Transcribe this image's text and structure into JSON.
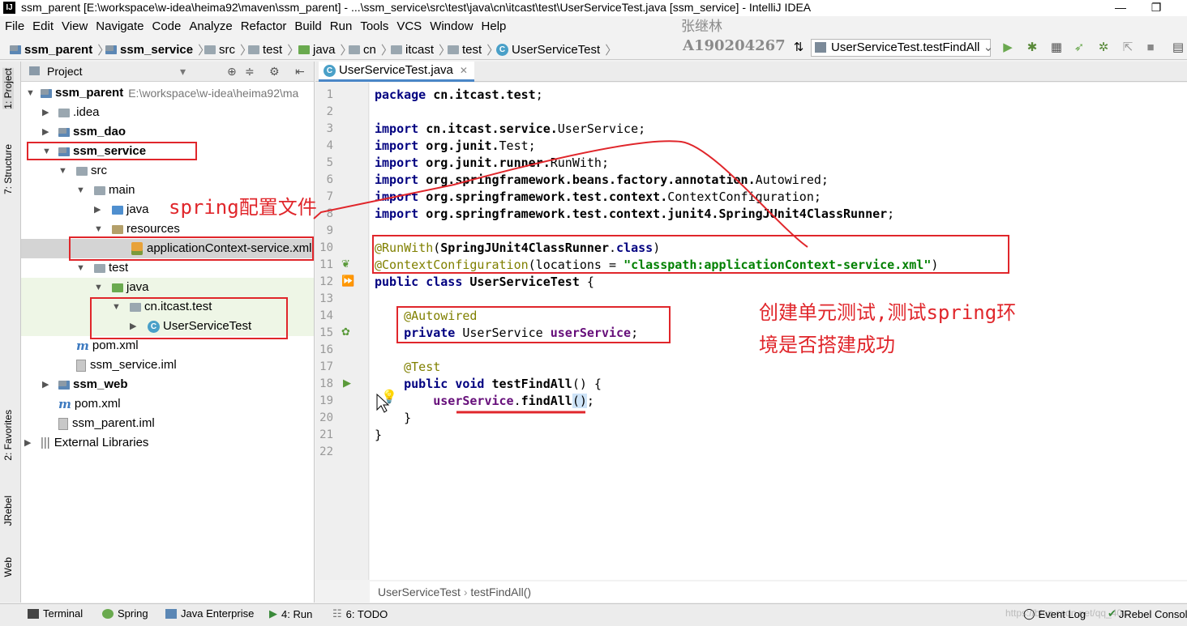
{
  "window": {
    "title": "ssm_parent [E:\\workspace\\w-idea\\heima92\\maven\\ssm_parent] - ...\\ssm_service\\src\\test\\java\\cn\\itcast\\test\\UserServiceTest.java [ssm_service] - IntelliJ IDEA",
    "app_icon_text": "IJ"
  },
  "menu": [
    "File",
    "Edit",
    "View",
    "Navigate",
    "Code",
    "Analyze",
    "Refactor",
    "Build",
    "Run",
    "Tools",
    "VCS",
    "Window",
    "Help"
  ],
  "watermark": {
    "name": "张继林",
    "id": "A190204267"
  },
  "navbar": {
    "crumbs": [
      "ssm_parent",
      "ssm_service",
      "src",
      "test",
      "java",
      "cn",
      "itcast",
      "test",
      "UserServiceTest"
    ],
    "run_config": "UserServiceTest.testFindAll"
  },
  "left_stripe": {
    "tabs": [
      "1: Project",
      "7: Structure",
      "2: Favorites",
      "JRebel",
      "Web"
    ]
  },
  "project": {
    "header": "Project",
    "tree": [
      {
        "label": "ssm_parent",
        "extra": "E:\\workspace\\w-idea\\heima92\\ma"
      },
      {
        "label": ".idea"
      },
      {
        "label": "ssm_dao"
      },
      {
        "label": "ssm_service"
      },
      {
        "label": "src"
      },
      {
        "label": "main"
      },
      {
        "label": "java"
      },
      {
        "label": "resources"
      },
      {
        "label": "applicationContext-service.xml"
      },
      {
        "label": "test"
      },
      {
        "label": "java"
      },
      {
        "label": "cn.itcast.test"
      },
      {
        "label": "UserServiceTest"
      },
      {
        "label": "pom.xml"
      },
      {
        "label": "ssm_service.iml"
      },
      {
        "label": "ssm_web"
      },
      {
        "label": "pom.xml"
      },
      {
        "label": "ssm_parent.iml"
      },
      {
        "label": "External Libraries"
      }
    ]
  },
  "editor": {
    "tab": "UserServiceTest.java",
    "line_numbers": [
      "1",
      "2",
      "3",
      "4",
      "5",
      "6",
      "7",
      "8",
      "9",
      "10",
      "11",
      "12",
      "13",
      "14",
      "15",
      "16",
      "17",
      "18",
      "19",
      "20",
      "21",
      "22"
    ],
    "breadcrumb": [
      "UserServiceTest",
      "testFindAll()"
    ]
  },
  "annotations": {
    "spring_config": "spring配置文件",
    "unit_test_line1": "创建单元测试,测试spring环",
    "unit_test_line2": "境是否搭建成功"
  },
  "bottom": {
    "tabs": [
      "Terminal",
      "Spring",
      "Java Enterprise",
      "4: Run",
      "6: TODO"
    ],
    "right": [
      "Event Log",
      "JRebel Console"
    ],
    "url_watermark": "https://blog.csdn.net/qq_40..."
  },
  "colors": {
    "annotation_red": "#e0262b",
    "keyword": "#000080",
    "annotation": "#808000",
    "string": "#008000"
  }
}
